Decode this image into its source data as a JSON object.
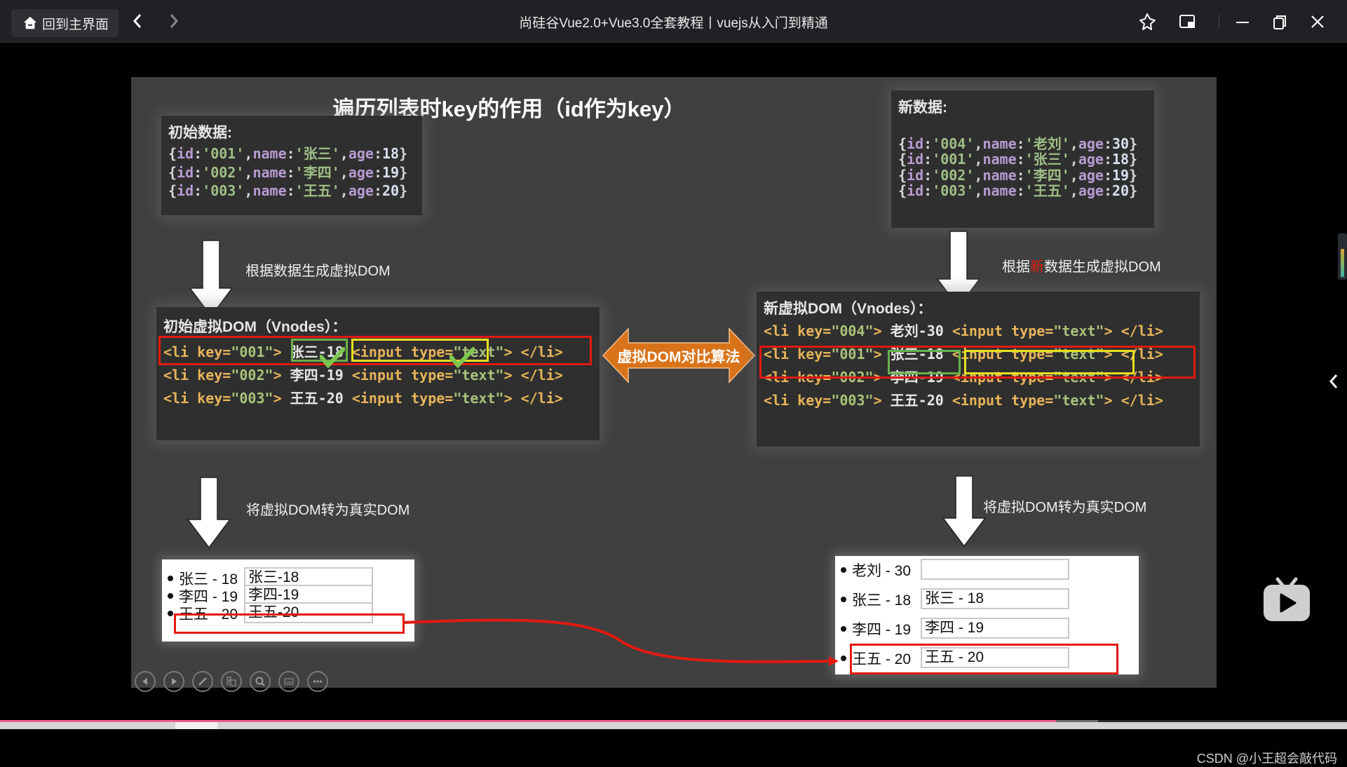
{
  "titlebar": {
    "home_label": "回到主界面",
    "title": "尚硅谷Vue2.0+Vue3.0全套教程丨vuejs从入门到精通",
    "icons": [
      "home-icon",
      "back-icon",
      "forward-icon",
      "pin-icon",
      "picture-in-picture-icon",
      "minimize-icon",
      "restore-icon",
      "close-icon"
    ]
  },
  "slide": {
    "title": "遍历列表时key的作用（id作为key）",
    "initial_data": {
      "heading": "初始数据:",
      "rows": [
        {
          "id": "001",
          "name": "张三",
          "age": "18"
        },
        {
          "id": "002",
          "name": "李四",
          "age": "19"
        },
        {
          "id": "003",
          "name": "王五",
          "age": "20"
        }
      ]
    },
    "new_data": {
      "heading": "新数据:",
      "rows": [
        {
          "id": "004",
          "name": "老刘",
          "age": "30"
        },
        {
          "id": "001",
          "name": "张三",
          "age": "18"
        },
        {
          "id": "002",
          "name": "李四",
          "age": "19"
        },
        {
          "id": "003",
          "name": "王五",
          "age": "20"
        }
      ]
    },
    "label_gen_left": "根据数据生成虚拟DOM",
    "label_gen_right_prefix": "根据",
    "label_gen_right_highlight": "新",
    "label_gen_right_suffix": "数据生成虚拟DOM",
    "highlight_color": "#e21a10",
    "initial_vdom": {
      "heading": "初始虚拟DOM（Vnodes）：",
      "rows": [
        {
          "key": "001",
          "text": "张三-18"
        },
        {
          "key": "002",
          "text": "李四-19"
        },
        {
          "key": "003",
          "text": "王五-20"
        }
      ]
    },
    "new_vdom": {
      "heading": "新虚拟DOM（Vnodes）：",
      "rows": [
        {
          "key": "004",
          "text": "老刘-30"
        },
        {
          "key": "001",
          "text": "张三-18"
        },
        {
          "key": "002",
          "text": "李四-19"
        },
        {
          "key": "003",
          "text": "王五-20"
        }
      ]
    },
    "code_tokens": {
      "li_open": "<li ",
      "key_attr": "key=",
      "close_gt": ">",
      "input_open": "<input ",
      "type_attr": "type=",
      "type_val": "\"text\"",
      "li_close": "</li>"
    },
    "compare_label": "虚拟DOM对比算法",
    "compare_color": "#d9731a",
    "label_real_left": "将虚拟DOM转为真实DOM",
    "label_real_right": "将虚拟DOM转为真实DOM",
    "real_dom_left": [
      {
        "label": "张三 - 18",
        "input": "张三-18"
      },
      {
        "label": "李四 - 19",
        "input": "李四-19"
      },
      {
        "label": "王五 - 20",
        "input": "王五-20"
      }
    ],
    "real_dom_right": [
      {
        "label": "老刘 - 30",
        "input": ""
      },
      {
        "label": "张三 - 18",
        "input": "张三 - 18"
      },
      {
        "label": "李四 - 19",
        "input": "李四 - 19"
      },
      {
        "label": "王五 - 20",
        "input": "王五 - 20"
      }
    ]
  },
  "player": {
    "toolbar_icons": [
      "prev-slide-icon",
      "next-slide-icon",
      "pen-icon",
      "slides-overview-icon",
      "zoom-icon",
      "subtitle-icon",
      "more-icon"
    ],
    "progress_percent": 78.4,
    "buffered_percent": 81.5,
    "watermark": "CSDN @小王超会敲代码",
    "accent_color": "#f0608a"
  }
}
